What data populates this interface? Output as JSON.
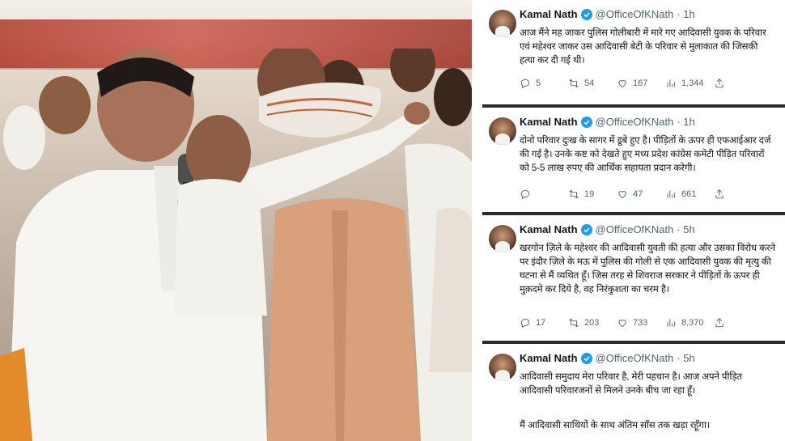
{
  "photo": {
    "description_icon": "rally-photo"
  },
  "tweets": [
    {
      "name": "Kamal Nath",
      "handle": "@OfficeOfKNath",
      "time": "· 1h",
      "text": "आज मैंने मह जाकर पुलिस गोलीबारी में मारे गए आदिवासी युवक के परिवार एवं महेश्वर जाकर उस आदिवासी बेटी के परिवार से मुलाकात की जिसकी हत्या कर दी गई थी।",
      "replies": "5",
      "retweets": "54",
      "likes": "167",
      "views": "1,344"
    },
    {
      "name": "Kamal Nath",
      "handle": "@OfficeOfKNath",
      "time": "· 1h",
      "text": "दोनो परिवार दुःख के सागर में डूबे हुए है। पीड़ितों के ऊपर ही एफआईआर दर्ज की गई है। उनके कष्ट को देखते हुए मध्य प्रदेश कांग्रेस कमेटी पीड़ित परिवारों को 5-5 लाख रुपए की आर्थिक सहायता प्रदान करेगी।",
      "replies": "",
      "retweets": "19",
      "likes": "47",
      "views": "661"
    },
    {
      "name": "Kamal Nath",
      "handle": "@OfficeOfKNath",
      "time": "· 5h",
      "text": "खरगोन ज़िले के महेश्वर की आदिवासी युवती की हत्या और उसका विरोध करने पर इंदौर ज़िले के मऊ में पुलिस की गोली से एक आदिवासी युवक की मृत्यु की घटना से मैं व्यथित हूँ। जिस तरह से शिवराज सरकार ने पीड़ितों के ऊपर ही मुक़दमे कर दिये है, वह निरंकुशता का चरम है।",
      "replies": "17",
      "retweets": "203",
      "likes": "733",
      "views": "8,370"
    },
    {
      "name": "Kamal Nath",
      "handle": "@OfficeOfKNath",
      "time": "· 5h",
      "text": "आदिवासी समुदाय मेरा परिवार है, मेरी पहचान है। आज अपने पीड़ित आदिवासी परिवारजनों से मिलने उनके बीच जा रहा हूँ।",
      "text2": "मैं आदिवासी साथियों के साथ अंतिम साँस तक खड़ा रहूँगा।"
    }
  ]
}
